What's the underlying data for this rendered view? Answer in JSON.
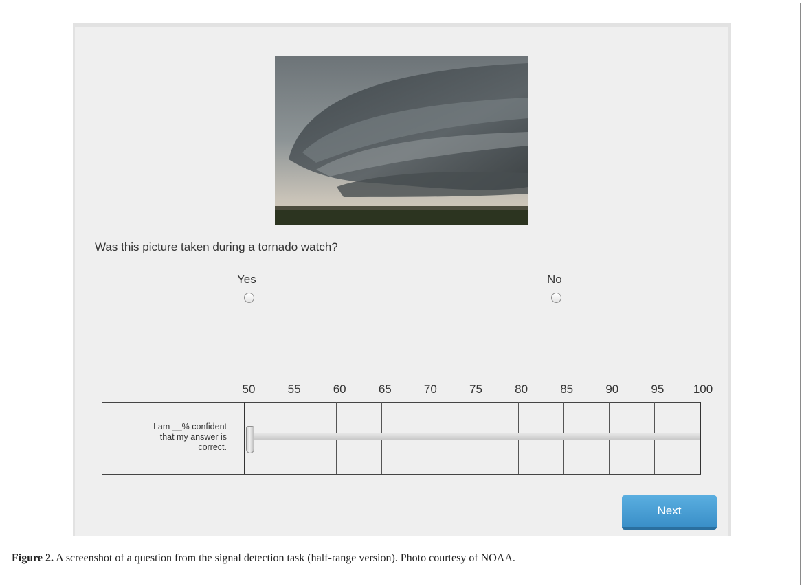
{
  "question": "Was this picture taken during a tornado watch?",
  "options": [
    {
      "label": "Yes",
      "selected": false
    },
    {
      "label": "No",
      "selected": false
    }
  ],
  "image": {
    "description_icon": "storm-photo"
  },
  "scale": {
    "ticks": [
      "50",
      "55",
      "60",
      "65",
      "70",
      "75",
      "80",
      "85",
      "90",
      "95",
      "100"
    ],
    "statement_line1": "I am __% confident",
    "statement_line2": "that my answer is",
    "statement_line3": "correct.",
    "slider_value": 50
  },
  "next_label": "Next",
  "caption": {
    "label": "Figure 2.",
    "text": " A screenshot of a question from the signal detection task (half-range version). Photo courtesy of NOAA."
  },
  "colors": {
    "button": "#3f97d0",
    "panel": "#efefef"
  }
}
